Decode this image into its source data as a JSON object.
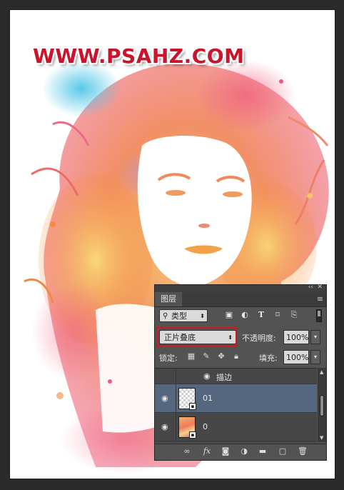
{
  "canvas": {
    "watermark": "WWW.PSAHZ.COM"
  },
  "colors": {
    "panel_bg": "#535353",
    "selected_layer": "#55677e",
    "highlight_box": "#d4141e",
    "watermark_red": "#c9142b"
  },
  "layers_panel": {
    "tab_label": "图层",
    "collapse_icon": "double-arrow-icon",
    "close_icon": "close-icon",
    "menu_icon": "panel-menu-icon",
    "filter": {
      "kind_label": "类型",
      "icons": [
        "image-filter-icon",
        "adjustment-filter-icon",
        "type-filter-icon",
        "shape-filter-icon",
        "smart-object-filter-icon"
      ]
    },
    "blend_mode": "正片叠底",
    "opacity_label": "不透明度:",
    "opacity_value": "100%",
    "lock_label": "锁定:",
    "fill_label": "填充:",
    "fill_value": "100%",
    "layers": [
      {
        "name": "描边",
        "type": "effect"
      },
      {
        "name": "01",
        "selected": true,
        "visible": true
      },
      {
        "name": "0",
        "selected": false,
        "visible": true
      }
    ],
    "bottom_icons": [
      "link-icon",
      "fx-icon",
      "mask-icon",
      "adjustment-icon",
      "group-icon",
      "new-layer-icon",
      "trash-icon"
    ]
  }
}
